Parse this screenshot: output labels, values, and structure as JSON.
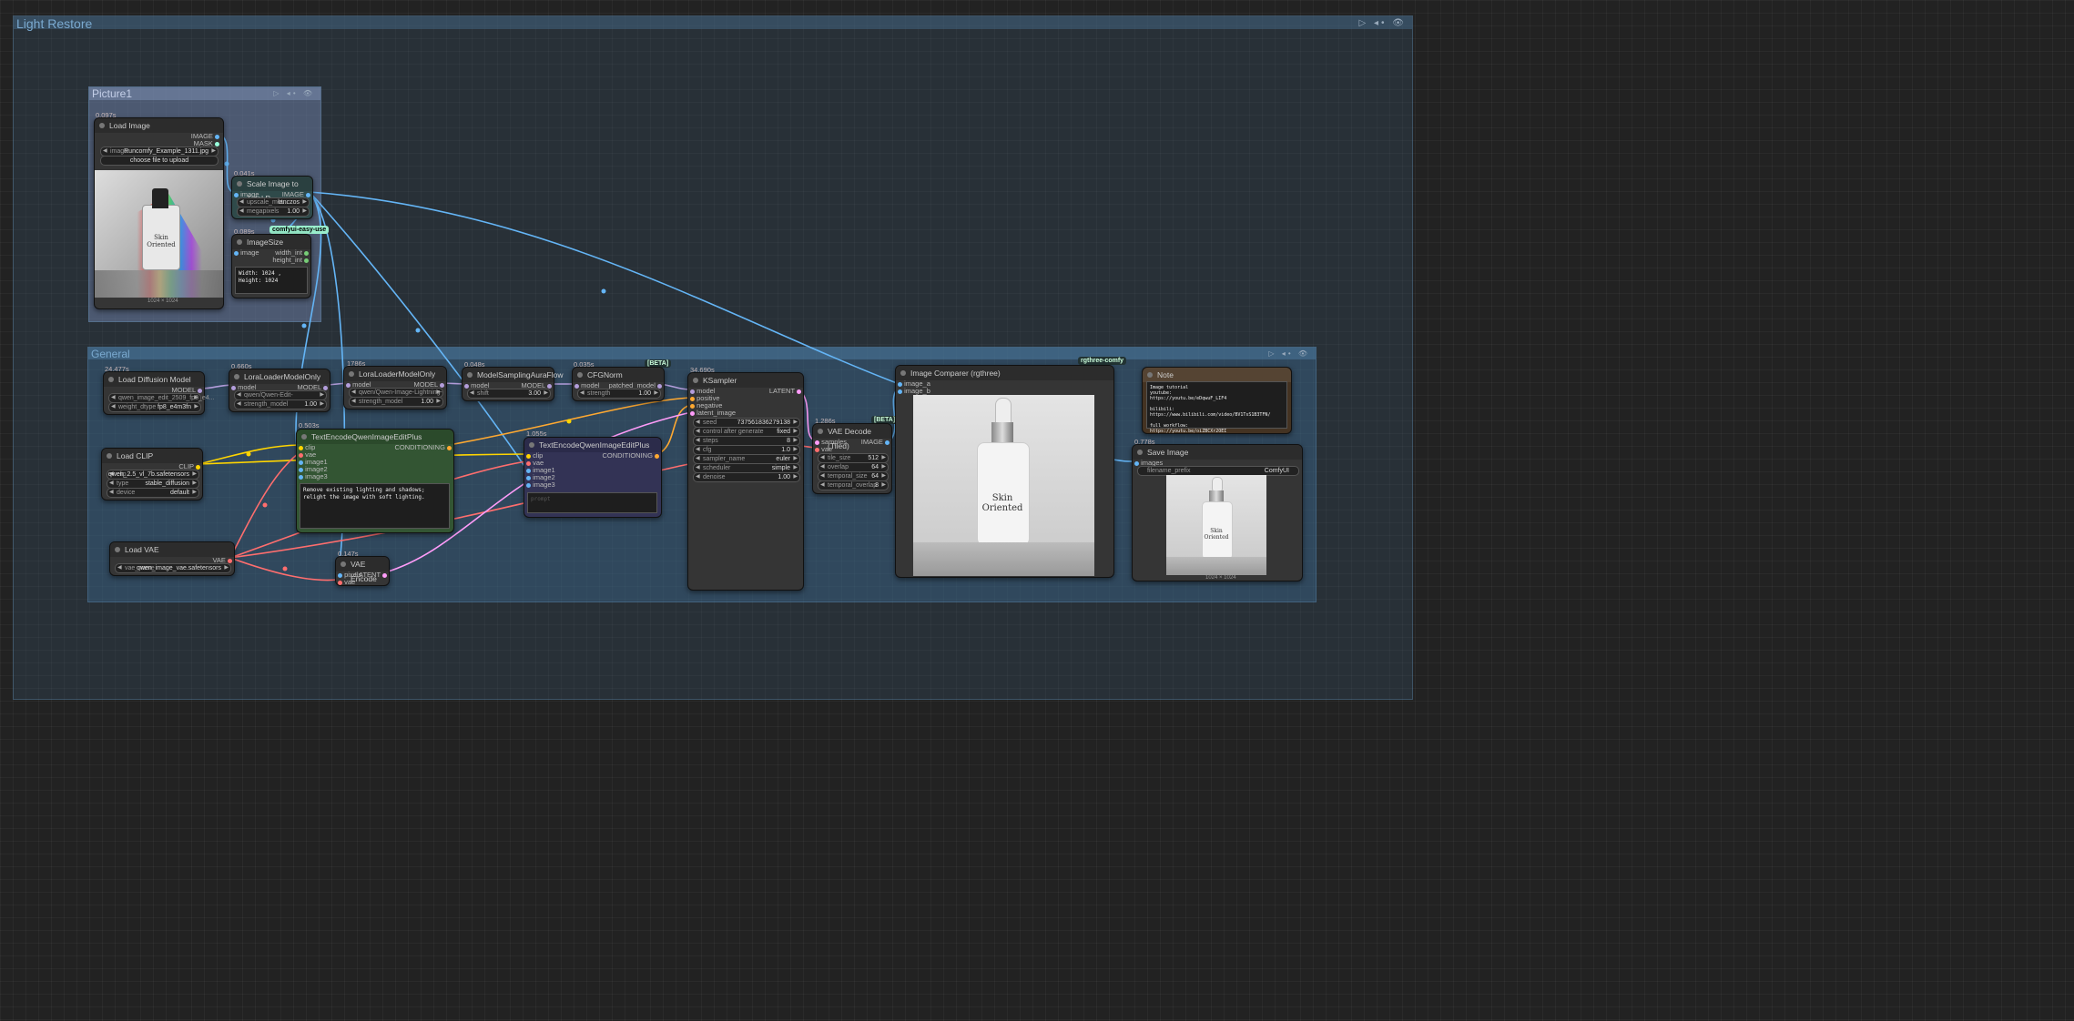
{
  "groups": {
    "light_restore": "Light Restore",
    "picture1": "Picture1",
    "general": "General"
  },
  "group_icons": "▷ ◂• 👁",
  "nodes": {
    "load_image": {
      "time": "0.097s",
      "title": "Load Image",
      "out_image": "IMAGE",
      "out_mask": "MASK",
      "image_label": "image",
      "image_value": "Runcomfy_Example_1311.jpg",
      "upload": "choose file to upload",
      "size": "1024 × 1024",
      "photo_brand": "Skin Oriented"
    },
    "scale_image": {
      "time": "0.041s",
      "title": "Scale Image to Total P...",
      "in_image": "image",
      "out_image": "IMAGE",
      "upscale_label": "upscale_met...",
      "upscale_value": "lanczos",
      "mp_label": "megapixels",
      "mp_value": "1.00"
    },
    "image_size": {
      "time": "0.089s",
      "badge": "comfyui-easy-use",
      "title": "ImageSize",
      "in_image": "image",
      "out_width": "width_int",
      "out_height": "height_int",
      "text": "Width: 1024 , Height: 1024"
    },
    "load_diffusion": {
      "time": "24.477s",
      "title": "Load Diffusion Model",
      "out_model": "MODEL",
      "unet_label": "",
      "unet_value": "qwen_image_edit_2509_fp8_e4...",
      "dtype_label": "weight_dtype",
      "dtype_value": "fp8_e4m3fn"
    },
    "lora1": {
      "time": "0.660s",
      "title": "LoraLoaderModelOnly",
      "in_model": "model",
      "out_model": "MODEL",
      "lora_value": "qwen/Qwen-Edit-Light_Restora...",
      "strength_label": "strength_model",
      "strength_value": "1.00"
    },
    "lora2": {
      "time": "1786s",
      "title": "LoraLoaderModelOnly",
      "in_model": "model",
      "out_model": "MODEL",
      "lora_value": "qwen/Qwen-Image-Lightning-8st...",
      "strength_label": "strength_model",
      "strength_value": "1.00"
    },
    "model_sampling": {
      "time": "0.048s",
      "title": "ModelSamplingAuraFlow",
      "in_model": "model",
      "out_model": "MODEL",
      "shift_label": "shift",
      "shift_value": "3.00"
    },
    "cfgnorm": {
      "time": "0.035s",
      "badge": "[BETA]",
      "title": "CFGNorm",
      "in_model": "model",
      "out_model": "patched_model",
      "strength_label": "strength",
      "strength_value": "1.00"
    },
    "ksampler": {
      "time": "34.690s",
      "title": "KSampler",
      "in_model": "model",
      "in_positive": "positive",
      "in_negative": "negative",
      "in_latent": "latent_image",
      "out_latent": "LATENT",
      "seed_label": "seed",
      "seed_value": "737561836279138",
      "cag_label": "control after generate",
      "cag_value": "fixed",
      "steps_label": "steps",
      "steps_value": "8",
      "cfg_label": "cfg",
      "cfg_value": "1.0",
      "sampler_label": "sampler_name",
      "sampler_value": "euler",
      "scheduler_label": "scheduler",
      "scheduler_value": "simple",
      "denoise_label": "denoise",
      "denoise_value": "1.00"
    },
    "load_clip": {
      "title": "Load CLIP",
      "out_clip": "CLIP",
      "clip_label": "clip...",
      "clip_value": "qwen_2.5_vl_7b.safetensors",
      "type_label": "type",
      "type_value": "stable_diffusion",
      "device_label": "device",
      "device_value": "default"
    },
    "text_encode1": {
      "time": "0.503s",
      "title": "TextEncodeQwenImageEditPlus",
      "in_clip": "clip",
      "in_vae": "vae",
      "in_image1": "image1",
      "in_image2": "image2",
      "in_image3": "image3",
      "out_cond": "CONDITIONING",
      "prompt": "Remove existing lighting and shadows; relight the image with soft lighting."
    },
    "text_encode2": {
      "time": "1.055s",
      "title": "TextEncodeQwenImageEditPlus",
      "in_clip": "clip",
      "in_vae": "vae",
      "in_image1": "image1",
      "in_image2": "image2",
      "in_image3": "image3",
      "out_cond": "CONDITIONING",
      "placeholder": "prompt"
    },
    "load_vae": {
      "title": "Load VAE",
      "out_vae": "VAE",
      "vae_label": "vae_name",
      "vae_value": "qwen_image_vae.safetensors"
    },
    "vae_encode": {
      "time": "0.147s",
      "title": "VAE Encode",
      "in_pixels": "pixels",
      "in_vae": "vae",
      "out_latent": "LATENT"
    },
    "vae_decode": {
      "time": "1.286s",
      "badge": "[BETA]",
      "title": "VAE Decode (Tiled)",
      "in_samples": "samples",
      "in_vae": "vae",
      "out_image": "IMAGE",
      "tile_label": "tile_size",
      "tile_value": "512",
      "overlap_label": "overlap",
      "overlap_value": "64",
      "tsize_label": "temporal_size",
      "tsize_value": "64",
      "toverlap_label": "temporal_overlap",
      "toverlap_value": "8"
    },
    "image_comparer": {
      "badge": "rgthree-comfy",
      "title": "Image Comparer (rgthree)",
      "in_a": "image_a",
      "in_b": "image_b",
      "photo_brand": "Skin Oriented"
    },
    "note": {
      "title": "Note",
      "text": "Image tutorial\nyoutube:\nhttps://youtu.be/eDqwuF_LIF4\n\nbilibili:\nhttps://www.bilibili.com/video/BV1TsS1B3TFN/\n\nfull workflow:\nhttps://youtu.be/oiZBCXr2OEI"
    },
    "save_image": {
      "time": "0.778s",
      "title": "Save Image",
      "in_images": "images",
      "prefix_label": "filename_prefix",
      "prefix_value": "ComfyUI",
      "size": "1024 × 1024",
      "photo_brand": "Skin Oriented"
    }
  },
  "colors": {
    "image": "#64b5f6",
    "model": "#b39ddb",
    "clip": "#ffd500",
    "vae": "#ff6e6e",
    "latent": "#ff9cf9",
    "conditioning": "#ffa931",
    "green_node": "#335533",
    "blue_node": "#333355"
  }
}
